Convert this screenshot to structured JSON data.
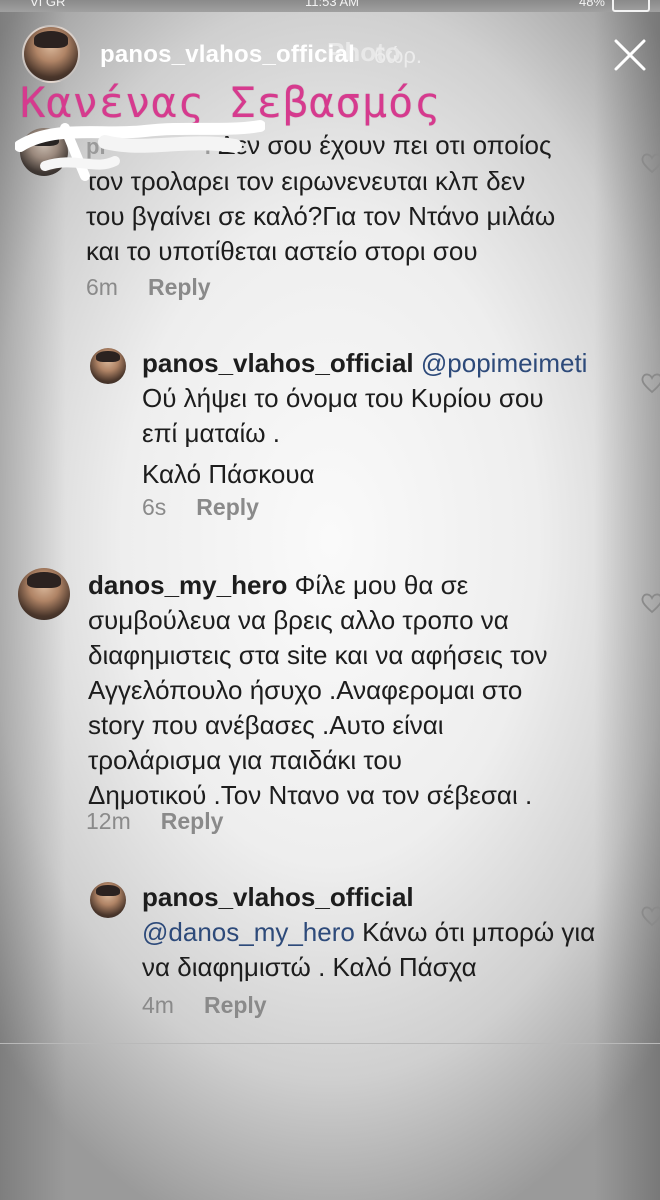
{
  "status_bar": {
    "carrier": "VI GR",
    "time": "11:53 AM",
    "battery": "48%"
  },
  "header": {
    "username": "panos_vlahos_official",
    "photo_title": "Photo",
    "time_ago": "6ώρ."
  },
  "overlay_text": "Κανένας Σεβασμός",
  "comments": [
    {
      "username_fragment": "pi",
      "text_fragment": "i",
      "text": "Δεν σου έχουν πει οτι οποίος τον τρολαρει τον ειρωνενευται κλπ δεν του βγαίνει σε καλό?Για τον Ντάνο μιλάω και το υποτίθεται αστείο στορι σου",
      "lines": [
        "Δεν σου έχουν πει οτι οποίος",
        "τον τρολαρει τον ειρωνενευται κλπ δεν",
        "του βγαίνει σε καλό?Για τον Ντάνο μιλάω",
        "και το υποτίθεται αστείο στορι σου"
      ],
      "time": "6m",
      "reply": "Reply"
    },
    {
      "username": "panos_vlahos_official",
      "mention": "@popimeimeti",
      "lines": [
        "Ού λήψει το όνομα του Κυρίου σου",
        "επί ματαίω .",
        "Καλό Πάσκουα"
      ],
      "time": "6s",
      "reply": "Reply"
    },
    {
      "username": "danos_my_hero",
      "first_line": "Φίλε μου θα σε",
      "lines": [
        "συμβούλευα να βρεις αλλο τροπο να",
        "διαφημιστεις στα site και να αφήσεις τον",
        "Αγγελόπουλο ήσυχο .Αναφερομαι στο",
        "story που ανέβασες .Αυτο είναι",
        "τρολάρισμα για παιδάκι του",
        "Δημοτικού .Τον Ντανο να τον σέβεσαι ."
      ],
      "time": "12m",
      "reply": "Reply"
    },
    {
      "username": "panos_vlahos_official",
      "mention": "@danos_my_hero",
      "first_line": "Κάνω ότι μπορώ για",
      "lines": [
        "να διαφημιστώ . Καλό Πάσχα"
      ],
      "time": "4m",
      "reply": "Reply"
    }
  ],
  "icons": {
    "close": "close-icon",
    "like": "heart-icon",
    "battery": "battery-icon"
  },
  "colors": {
    "overlay_text": "#d63a8e",
    "mention": "#2d4a7a",
    "meta": "#8a8a8a"
  }
}
